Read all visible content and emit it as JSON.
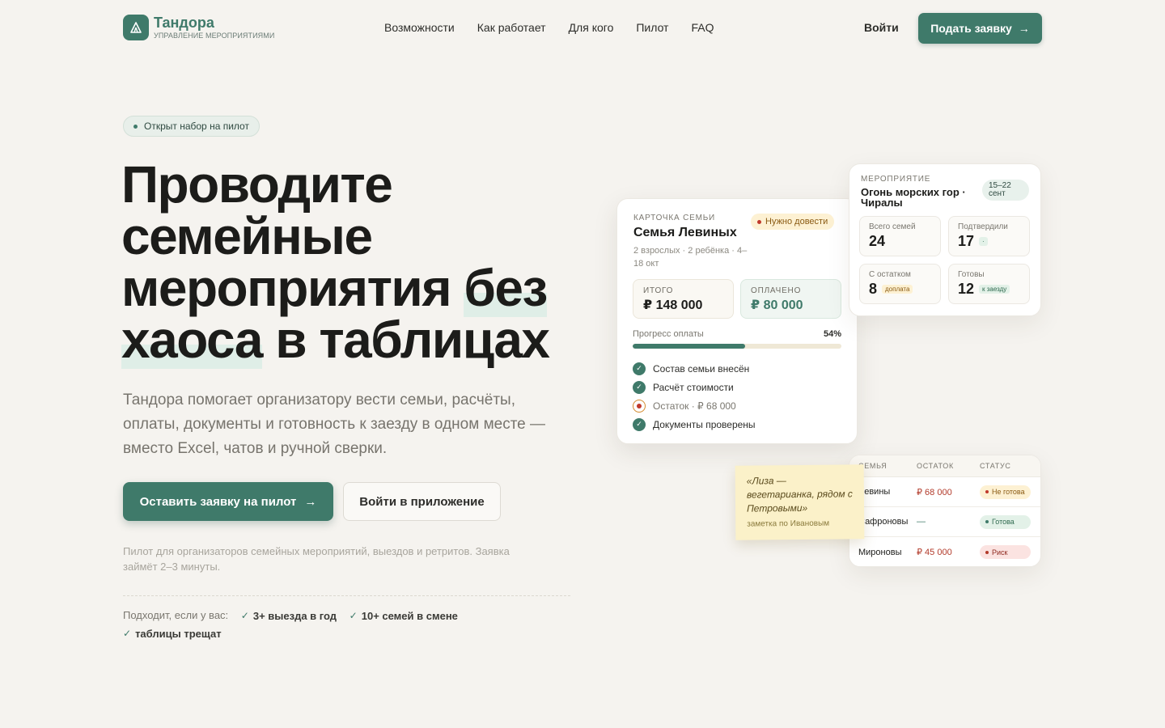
{
  "brand": {
    "name": "Тандора",
    "tagline": "УПРАВЛЕНИЕ МЕРОПРИЯТИЯМИ",
    "accent": "#3f7a6a"
  },
  "nav": {
    "items": [
      "Возможности",
      "Как работает",
      "Для кого",
      "Пилот",
      "FAQ"
    ]
  },
  "header": {
    "login": "Войти",
    "apply": "Подать заявку"
  },
  "hero": {
    "badge": "Открыт набор на пилот",
    "title_l1": "Проводите",
    "title_l2": "семейные",
    "title_l3a": "мероприятия ",
    "title_l3b": "без",
    "title_l4a": "хаоса",
    "title_l4b": " в таблицах",
    "description": "Тандора помогает организатору вести семьи, расчёты, оплаты, документы и готовность к заезду в одном месте — вместо Excel, чатов и ручной сверки.",
    "cta_primary": "Оставить заявку на пилот",
    "cta_secondary": "Войти в приложение",
    "note": "Пилот для организаторов семейных мероприятий, выездов и ретритов. Заявка займёт 2–3 минуты.",
    "fits_label": "Подходит, если у вас:",
    "fits": [
      "3+ выезда в год",
      "10+ семей в смене",
      "таблицы трещат"
    ]
  },
  "family_card": {
    "label": "КАРТОЧКА СЕМЬИ",
    "name": "Семья Левиных",
    "meta": "2 взрослых · 2 ребёнка · 4–18 окт",
    "status": "Нужно довести",
    "total_label": "ИТОГО",
    "total": "₽ 148 000",
    "paid_label": "ОПЛАЧЕНО",
    "paid": "₽ 80 000",
    "progress_label": "Прогресс оплаты",
    "progress_text": "54%",
    "progress_value": 0.54,
    "checklist": [
      {
        "text": "Состав семьи внесён",
        "state": "done"
      },
      {
        "text": "Расчёт стоимости",
        "state": "done"
      },
      {
        "text": "Остаток · ₽ 68 000",
        "state": "pending"
      },
      {
        "text": "Документы проверены",
        "state": "done"
      }
    ]
  },
  "event_card": {
    "label": "МЕРОПРИЯТИЕ",
    "name": "Огонь морских гор · Чиралы",
    "dates": "15–22 сент",
    "stats": [
      {
        "label": "Всего семей",
        "value": "24",
        "tag": ""
      },
      {
        "label": "Подтвердили",
        "value": "17",
        "tag": "·"
      },
      {
        "label": "С остатком",
        "value": "8",
        "tag": "доплата"
      },
      {
        "label": "Готовы",
        "value": "12",
        "tag": "к заезду"
      }
    ]
  },
  "table_card": {
    "headers": [
      "СЕМЬЯ",
      "ОСТАТОК",
      "СТАТУС"
    ],
    "rows": [
      {
        "family": "Левины",
        "balance": "₽ 68 000",
        "status": "Не готова"
      },
      {
        "family": "Сафроновы",
        "balance": "—",
        "status": "Готова"
      },
      {
        "family": "Мироновы",
        "balance": "₽ 45 000",
        "status": "Риск"
      }
    ]
  },
  "sticky_note": {
    "text": "«Лиза — вегетарианка, рядом с Петровыми»",
    "sign": "заметка по Ивановым"
  }
}
